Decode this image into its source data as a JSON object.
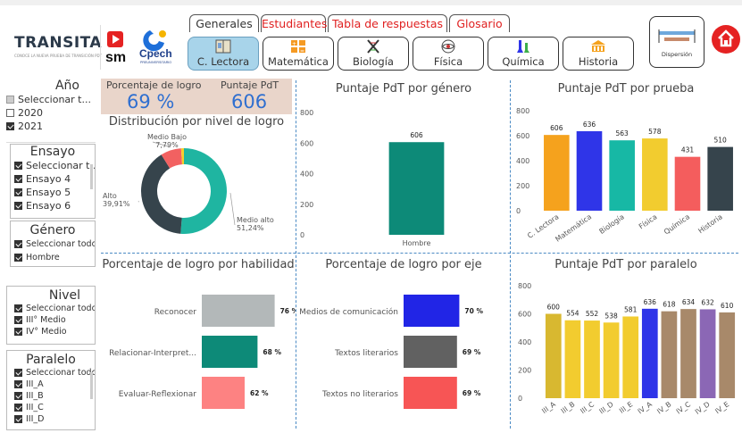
{
  "brand": {
    "name": "TRANSITA",
    "tagline": "CONOCE LA NUEVA PRUEBA DE TRANSICIÓN PDT",
    "sm": "sm",
    "cpech": "Cpech",
    "cpech_tag": "PREUNIVERSITARIO"
  },
  "tabs": [
    {
      "label": "Generales",
      "color": "#333333"
    },
    {
      "label": "Estudiantes",
      "color": "#e02020"
    },
    {
      "label": "Tabla de respuestas",
      "color": "#e02020"
    },
    {
      "label": "Glosario",
      "color": "#e02020"
    }
  ],
  "subjects": [
    {
      "label": "C. Lectora",
      "icon": "book-icon",
      "active": true
    },
    {
      "label": "Matemática",
      "icon": "math-icon",
      "active": false
    },
    {
      "label": "Biología",
      "icon": "dna-icon",
      "active": false
    },
    {
      "label": "Física",
      "icon": "atom-icon",
      "active": false
    },
    {
      "label": "Química",
      "icon": "flask-icon",
      "active": false
    },
    {
      "label": "Historia",
      "icon": "building-icon",
      "active": false
    }
  ],
  "dispersion_label": "Dispersión",
  "filters": {
    "anio": {
      "title": "Año",
      "items": [
        {
          "label": "Seleccionar t...",
          "state": "partial"
        },
        {
          "label": "2020",
          "state": "off"
        },
        {
          "label": "2021",
          "state": "on"
        }
      ]
    },
    "ensayo": {
      "title": "Ensayo",
      "items": [
        {
          "label": "Seleccionar t...",
          "state": "on"
        },
        {
          "label": "Ensayo 4",
          "state": "on"
        },
        {
          "label": "Ensayo 5",
          "state": "on"
        },
        {
          "label": "Ensayo 6",
          "state": "on"
        }
      ]
    },
    "genero": {
      "title": "Género",
      "items": [
        {
          "label": "Seleccionar todo",
          "state": "on"
        },
        {
          "label": "Hombre",
          "state": "on"
        }
      ]
    },
    "nivel": {
      "title": "Nivel",
      "items": [
        {
          "label": "Seleccionar todo",
          "state": "on"
        },
        {
          "label": "III° Medio",
          "state": "on"
        },
        {
          "label": "IV° Medio",
          "state": "on"
        }
      ]
    },
    "paralelo": {
      "title": "Paralelo",
      "items": [
        {
          "label": "Seleccionar todo",
          "state": "on"
        },
        {
          "label": "III_A",
          "state": "on"
        },
        {
          "label": "III_B",
          "state": "on"
        },
        {
          "label": "III_C",
          "state": "on"
        },
        {
          "label": "III_D",
          "state": "on"
        }
      ]
    }
  },
  "kpi": {
    "logro_title": "Porcentaje de logro",
    "logro_value": "69 %",
    "pdt_title": "Puntaje PdT",
    "pdt_value": "606"
  },
  "titles": {
    "distribucion": "Distribución por nivel de logro",
    "genero": "Puntaje PdT por género",
    "prueba": "Puntaje PdT por prueba",
    "habilidad": "Porcentaje de logro por habilidad",
    "eje": "Porcentaje de logro por eje",
    "paralelo": "Puntaje PdT por paralelo"
  },
  "chart_data": [
    {
      "id": "distribucion",
      "type": "pie",
      "title": "Distribución por nivel de logro",
      "slices": [
        {
          "label": "Medio alto",
          "value": 51.24,
          "display": "51,24%",
          "color": "#1fb5a1"
        },
        {
          "label": "Alto",
          "value": 39.91,
          "display": "39,91%",
          "color": "#36444c"
        },
        {
          "label": "Medio Bajo",
          "value": 7.79,
          "display": "7,79%",
          "color": "#f26161"
        },
        {
          "label": "",
          "value": 1.06,
          "display": "",
          "color": "#f5cf2a"
        }
      ]
    },
    {
      "id": "genero",
      "type": "bar",
      "title": "Puntaje PdT por género",
      "categories": [
        "Hombre"
      ],
      "values": [
        606
      ],
      "colors": [
        "#0d8a78"
      ],
      "ylim": [
        0,
        800
      ],
      "yticks": [
        0,
        200,
        400,
        600,
        800
      ]
    },
    {
      "id": "prueba",
      "type": "bar",
      "title": "Puntaje PdT por prueba",
      "categories": [
        "C. Lectora",
        "Matemática",
        "Biología",
        "Física",
        "Química",
        "Historia"
      ],
      "values": [
        606,
        636,
        563,
        578,
        431,
        510
      ],
      "colors": [
        "#f5a21d",
        "#2f35e8",
        "#17b8a5",
        "#f2cc2f",
        "#f45d5d",
        "#36444c"
      ],
      "ylim": [
        0,
        800
      ],
      "yticks": [
        0,
        200,
        400,
        600,
        800
      ]
    },
    {
      "id": "habilidad",
      "type": "bar",
      "orientation": "horizontal",
      "title": "Porcentaje de logro por habilidad",
      "categories": [
        "Reconocer",
        "Relacionar-Interpret...",
        "Evaluar-Reflexionar"
      ],
      "values": [
        76,
        68,
        62
      ],
      "labels": [
        "76 %",
        "68 %",
        "62 %"
      ],
      "colors": [
        "#b3b8b9",
        "#0d8a78",
        "#fd8282"
      ],
      "xlim": [
        0,
        100
      ]
    },
    {
      "id": "eje",
      "type": "bar",
      "orientation": "horizontal",
      "title": "Porcentaje de logro por eje",
      "categories": [
        "Medios de comunicación",
        "Textos literarios",
        "Textos no literarios"
      ],
      "values": [
        70,
        69,
        69
      ],
      "labels": [
        "70 %",
        "69 %",
        "69 %"
      ],
      "colors": [
        "#2125e6",
        "#616161",
        "#f75555"
      ],
      "xlim": [
        0,
        100
      ]
    },
    {
      "id": "paralelo",
      "type": "bar",
      "title": "Puntaje PdT por paralelo",
      "categories": [
        "III_A",
        "III_B",
        "III_C",
        "III_D",
        "III_E",
        "IV_A",
        "IV_B",
        "IV_C",
        "IV_D",
        "IV_E"
      ],
      "values": [
        600,
        554,
        552,
        538,
        581,
        636,
        618,
        634,
        632,
        610
      ],
      "colors": [
        "#d8b830",
        "#f2cc2f",
        "#f2cc2f",
        "#f2cc2f",
        "#f2cc2f",
        "#2f35e8",
        "#a8896a",
        "#a8896a",
        "#8b67b5",
        "#a8896a"
      ],
      "ylim": [
        0,
        800
      ],
      "yticks": [
        0,
        200,
        400,
        600,
        800
      ]
    }
  ]
}
